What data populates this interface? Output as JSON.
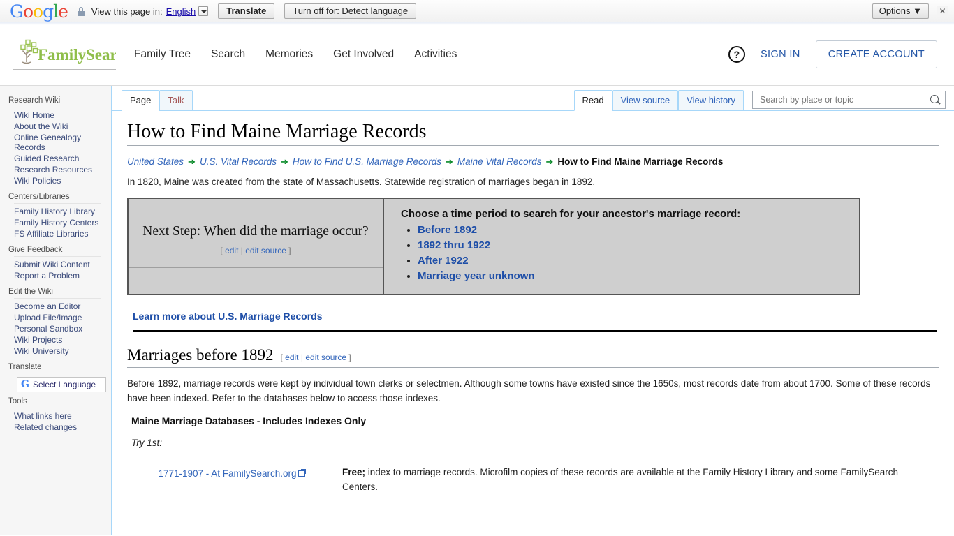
{
  "translate_bar": {
    "logo": "Google",
    "lock_icon": "lock-icon",
    "view_label": "View this page in:",
    "language": "English",
    "translate_button": "Translate",
    "turn_off_button": "Turn off for: Detect language",
    "options_button": "Options ▼",
    "close_icon": "✕"
  },
  "header": {
    "logo_text": "FamilySearch",
    "nav": [
      {
        "label": "Family Tree"
      },
      {
        "label": "Search"
      },
      {
        "label": "Memories"
      },
      {
        "label": "Get Involved"
      },
      {
        "label": "Activities"
      }
    ],
    "help_icon": "?",
    "sign_in": "SIGN IN",
    "create_account": "CREATE ACCOUNT"
  },
  "sidebar": {
    "sections": [
      {
        "heading": "Research Wiki",
        "items": [
          "Wiki Home",
          "About the Wiki",
          "Online Genealogy Records",
          "Guided Research",
          "Research Resources",
          "Wiki Policies"
        ]
      },
      {
        "heading": "Centers/Libraries",
        "items": [
          "Family History Library",
          "Family History Centers",
          "FS Affiliate Libraries"
        ]
      },
      {
        "heading": "Give Feedback",
        "items": [
          "Submit Wiki Content",
          "Report a Problem"
        ]
      },
      {
        "heading": "Edit the Wiki",
        "items": [
          "Become an Editor",
          "Upload File/Image",
          "Personal Sandbox",
          "Wiki Projects",
          "Wiki University"
        ]
      }
    ],
    "translate_heading": "Translate",
    "select_language": "Select Language",
    "select_language_icon": "G",
    "tools_heading": "Tools",
    "tools_items": [
      "What links here",
      "Related changes"
    ]
  },
  "tabs": {
    "left": [
      {
        "label": "Page",
        "selected": true
      },
      {
        "label": "Talk",
        "selected": false,
        "newpage": true
      }
    ],
    "right": [
      {
        "label": "Read",
        "selected": true
      },
      {
        "label": "View source",
        "selected": false
      },
      {
        "label": "View history",
        "selected": false
      }
    ]
  },
  "search": {
    "placeholder": "Search by place or topic",
    "value": "",
    "icon": "search-icon"
  },
  "article": {
    "title": "How to Find Maine Marriage Records",
    "breadcrumb": {
      "links": [
        "United States",
        "U.S. Vital Records",
        "How to Find U.S. Marriage Records",
        "Maine Vital Records"
      ],
      "arrow": "➔",
      "current": "How to Find Maine Marriage Records"
    },
    "intro": "In 1820, Maine was created from the state of Massachusetts. Statewide registration of marriages began in 1892.",
    "next_step": {
      "title": "Next Step: When did the marriage occur?",
      "edit_open": "[",
      "edit": "edit",
      "edit_sep": "|",
      "edit_source": "edit source",
      "edit_close": "]",
      "question": "Choose a time period to search for your ancestor's marriage record:",
      "options": [
        "Before 1892",
        "1892 thru 1922",
        "After 1922",
        "Marriage year unknown"
      ]
    },
    "learn_more": "Learn more about U.S. Marriage Records",
    "section": {
      "heading": "Marriages before 1892",
      "edit_open": "[",
      "edit": "edit",
      "edit_sep": "|",
      "edit_source": "edit source",
      "edit_close": "]",
      "paragraph": "Before 1892, marriage records were kept by individual town clerks or selectmen. Although some towns have existed since the 1650s, most records date from about 1700. Some of these records have been indexed. Refer to the databases below to access those indexes.",
      "subheading_bold": "Maine Marriage Databases",
      "subheading_rest": " - Includes Indexes Only",
      "try_label": "Try 1st:",
      "rows": [
        {
          "name": "1771-1907 - At FamilySearch.org",
          "external_icon": "external-link-icon",
          "desc_bold": "Free;",
          "desc": " index to marriage records. Microfilm copies of these records are available at the Family History Library and some FamilySearch Centers."
        }
      ]
    }
  },
  "colors": {
    "link_blue": "#3366bb",
    "strong_link_blue": "#1f4fa8",
    "fs_green": "#8fbe4a",
    "arrow_green": "#0a8a2a",
    "tab_border": "#a7d7f9",
    "newpage_red": "#a55858"
  }
}
